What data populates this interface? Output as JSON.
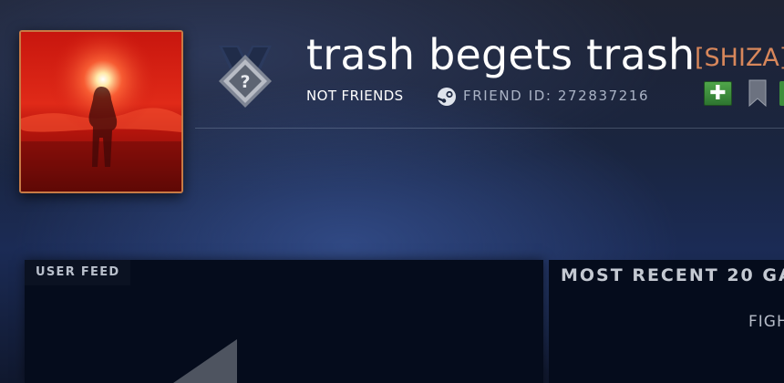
{
  "profile": {
    "name": "trash begets trash",
    "tag": "[SHIZA]",
    "relationship": "NOT FRIENDS",
    "friend_id_label": "FRIEND ID: 272837216"
  },
  "icons": {
    "avatar": "player-avatar-image",
    "rank": "unknown-rank-medal-icon",
    "steam": "steam-icon",
    "add": "plus-icon",
    "bookmark": "bookmark-icon"
  },
  "actions": {
    "add_friend_glyph": "✚"
  },
  "panels": {
    "user_feed_title": "USER FEED",
    "recent_games_title": "MOST RECENT 20 GA",
    "recent_games_sub": "FIGH"
  },
  "colors": {
    "tag": "#d8875b",
    "add_button": "#3e8f3c",
    "avatar_border": "#c87a45"
  }
}
